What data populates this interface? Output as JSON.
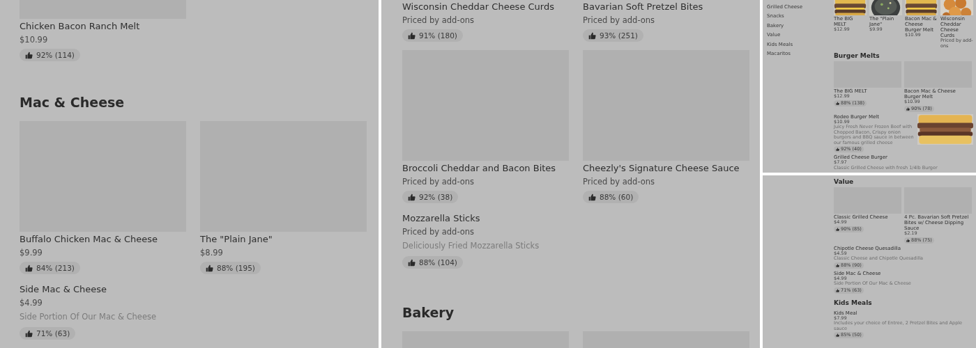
{
  "panels": [
    {
      "kind": "full",
      "blocks": [
        {
          "kind": "grid",
          "items": [
            {
              "name": "Chicken Bacon Ranch Melt",
              "price": "$10.99",
              "rating": "92% (114)",
              "media": {
                "kind": "placeholder"
              }
            }
          ]
        },
        {
          "kind": "heading",
          "title": "Mac & Cheese"
        },
        {
          "kind": "grid",
          "items": [
            {
              "name": "Buffalo Chicken Mac & Cheese",
              "price": "$9.99",
              "rating": "84% (213)",
              "media": {
                "kind": "placeholder"
              }
            },
            {
              "name": "The \"Plain Jane\"",
              "price": "$8.99",
              "rating": "88% (195)",
              "media": {
                "kind": "placeholder"
              }
            }
          ]
        },
        {
          "kind": "list",
          "items": [
            {
              "name": "Side Mac & Cheese",
              "price": "$4.99",
              "description": "Side Portion Of Our Mac & Cheese",
              "rating": "71% (63)"
            }
          ]
        }
      ]
    },
    {
      "kind": "full",
      "blocks": [
        {
          "kind": "grid",
          "items": [
            {
              "name": "Wisconsin Cheddar Cheese Curds",
              "price": "Priced by add-ons",
              "rating": "91% (180)"
            },
            {
              "name": "Bavarian Soft Pretzel Bites",
              "price": "Priced by add-ons",
              "rating": "93% (251)"
            }
          ]
        },
        {
          "kind": "grid",
          "items": [
            {
              "name": "Broccoli Cheddar and Bacon Bites",
              "price": "Priced by add-ons",
              "rating": "92% (38)",
              "media": {
                "kind": "placeholder"
              }
            },
            {
              "name": "Cheezly's Signature Cheese Sauce",
              "price": "Priced by add-ons",
              "rating": "88% (60)",
              "media": {
                "kind": "placeholder"
              }
            }
          ]
        },
        {
          "kind": "list",
          "items": [
            {
              "name": "Mozzarella Sticks",
              "price": "Priced by add-ons",
              "description": "Deliciously Fried Mozzarella Sticks",
              "rating": "88% (104)"
            }
          ]
        },
        {
          "kind": "heading",
          "title": "Bakery"
        },
        {
          "kind": "grid",
          "items": [
            {
              "media": {
                "kind": "placeholder"
              }
            },
            {
              "media": {
                "kind": "placeholder"
              }
            }
          ]
        }
      ]
    },
    {
      "kind": "overview",
      "sidebar": [
        "Grilled Cheese",
        "Snacks",
        "Bakery",
        "Value",
        "Kids Meals",
        "Macaritos"
      ],
      "blocks": [
        {
          "kind": "carousel",
          "items": [
            {
              "name": "The BIG MELT",
              "price": "$12.99"
            },
            {
              "name": "The \"Plain Jane\"",
              "price": "$9.99"
            },
            {
              "name": "Bacon Mac & Cheese Burger Melt",
              "price": "$10.99"
            },
            {
              "name": "Wisconsin Cheddar Cheese Curds",
              "price": "Priced by add-ons"
            }
          ]
        },
        {
          "kind": "heading",
          "title": "Burger Melts"
        },
        {
          "kind": "grid",
          "items": [
            {
              "name": "The BIG MELT",
              "price": "$12.99",
              "rating": "88% (138)",
              "media": {
                "kind": "placeholder"
              }
            },
            {
              "name": "Bacon Mac & Cheese Burger Melt",
              "price": "$10.99",
              "rating": "90% (78)",
              "media": {
                "kind": "placeholder"
              }
            }
          ]
        },
        {
          "kind": "list",
          "items": [
            {
              "name": "Rodeo Burger Melt",
              "price": "$10.99",
              "description": "Juicy Fresh Never Frozen Beef with Chopped Bacon, Crispy onion burgers and BBQ sauce in between our famous grilled cheese",
              "rating": "92% (40)"
            },
            {
              "name": "Grilled Cheese Burger",
              "price": "$7.97",
              "description": "Classic Grilled Cheese with fresh 1/4lb Burger"
            }
          ]
        }
      ]
    },
    {
      "kind": "overview",
      "blocks": [
        {
          "kind": "heading",
          "title": "Value"
        },
        {
          "kind": "grid",
          "items": [
            {
              "name": "Classic Grilled Cheese",
              "price": "$4.99",
              "rating": "90% (85)",
              "media": {
                "kind": "placeholder"
              }
            },
            {
              "name": "4 Pc. Bavarian Soft Pretzel Bites w/ Cheese Dipping Sauce",
              "price": "$2.19",
              "rating": "88% (75)",
              "media": {
                "kind": "placeholder"
              }
            }
          ]
        },
        {
          "kind": "list",
          "items": [
            {
              "name": "Chipotle Cheese Quesadilla",
              "price": "$4.59",
              "description": "Classic Cheese and Chipotle Quesadilla",
              "rating": "88% (90)"
            },
            {
              "name": "Side Mac & Cheese",
              "price": "$4.99",
              "description": "Side Portion Of Our Mac & Cheese",
              "rating": "71% (63)"
            }
          ]
        },
        {
          "kind": "heading",
          "title": "Kids Meals"
        },
        {
          "kind": "list",
          "items": [
            {
              "name": "Kids Meal",
              "price": "$7.99",
              "description": "Includes your choice of Entree, 2 Pretzel Bites and Apple sauce",
              "rating": "85% (50)"
            }
          ]
        }
      ]
    }
  ]
}
